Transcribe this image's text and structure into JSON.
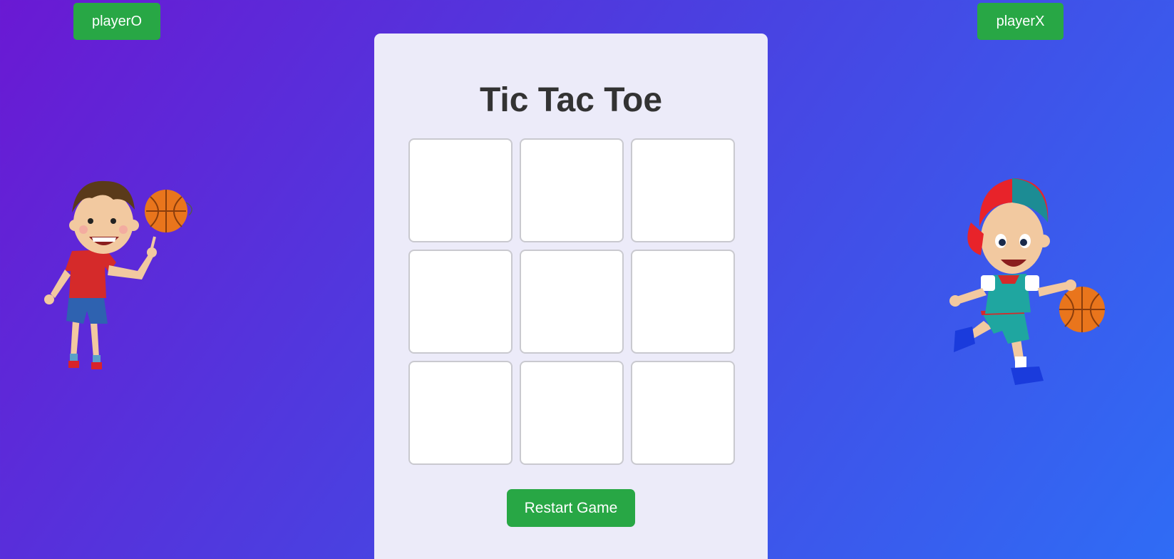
{
  "players": {
    "o_label": "playerO",
    "x_label": "playerX"
  },
  "game": {
    "title": "Tic Tac Toe",
    "board": [
      "",
      "",
      "",
      "",
      "",
      "",
      "",
      "",
      ""
    ],
    "restart_label": "Restart Game"
  },
  "colors": {
    "button_green": "#28a745",
    "panel_background": "#ecebf9",
    "background_gradient_start": "#6a19d3",
    "background_gradient_end": "#2f6cf5"
  },
  "icons": {
    "player_o_avatar": "boy-spinning-basketball-avatar",
    "player_x_avatar": "boy-dribbling-basketball-avatar"
  }
}
